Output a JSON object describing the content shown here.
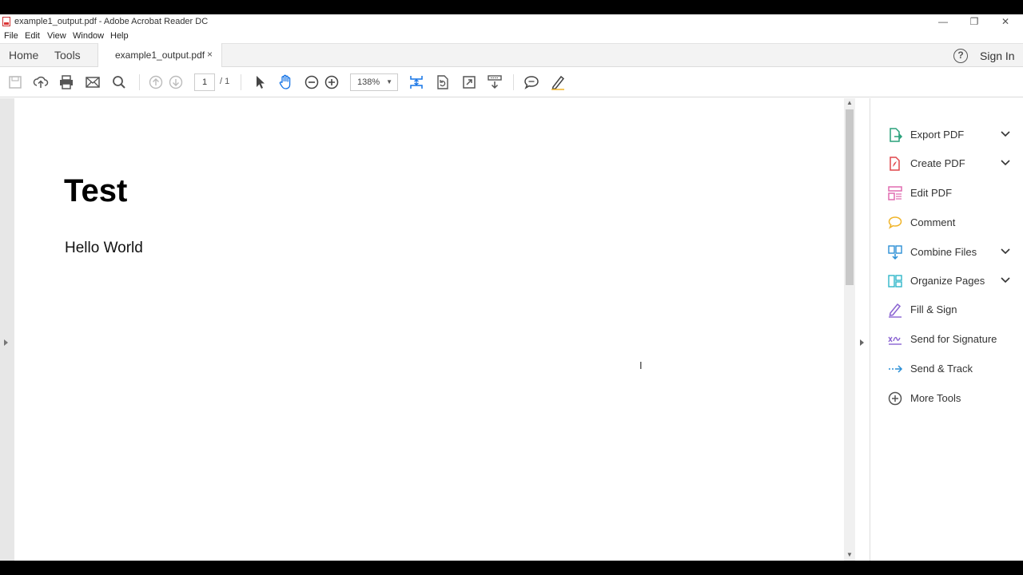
{
  "window": {
    "title": "example1_output.pdf - Adobe Acrobat Reader DC",
    "minimize": "—",
    "restore": "❐",
    "close": "✕"
  },
  "menu": [
    "File",
    "Edit",
    "View",
    "Window",
    "Help"
  ],
  "nav": {
    "home": "Home",
    "tools": "Tools",
    "doc_tab": "example1_output.pdf",
    "doc_tab_close": "×",
    "help": "?",
    "sign_in": "Sign In"
  },
  "toolbar": {
    "icons": [
      "save-icon",
      "upload-icon",
      "print-icon",
      "email-icon",
      "search-icon",
      "page-up-icon",
      "page-down-icon",
      "select-arrow-icon",
      "hand-icon",
      "zoom-out-icon",
      "zoom-in-icon",
      "fit-page-icon",
      "rotate-icon",
      "full-screen-icon",
      "scroll-mode-icon",
      "comment-icon",
      "highlight-pen-icon"
    ],
    "page_current": "1",
    "page_total": "/ 1",
    "zoom": "138%",
    "zoom_caret": "▼"
  },
  "document": {
    "heading": "Test",
    "body": "Hello World"
  },
  "scrollbar": {
    "up": "▲",
    "down": "▼"
  },
  "cursor": "I",
  "tools_pane": [
    {
      "label": "Export PDF",
      "icon": "export-pdf-icon",
      "color": "#28a07a",
      "expandable": true
    },
    {
      "label": "Create PDF",
      "icon": "create-pdf-icon",
      "color": "#e0464b",
      "expandable": true
    },
    {
      "label": "Edit PDF",
      "icon": "edit-pdf-icon",
      "color": "#e06bb0",
      "expandable": false
    },
    {
      "label": "Comment",
      "icon": "comment-icon",
      "color": "#f0b429",
      "expandable": false
    },
    {
      "label": "Combine Files",
      "icon": "combine-files-icon",
      "color": "#2b8fd6",
      "expandable": true
    },
    {
      "label": "Organize Pages",
      "icon": "organize-pages-icon",
      "color": "#2fb6c9",
      "expandable": true
    },
    {
      "label": "Fill & Sign",
      "icon": "fill-sign-icon",
      "color": "#8a63d2",
      "expandable": false
    },
    {
      "label": "Send for Signature",
      "icon": "send-signature-icon",
      "color": "#8a63d2",
      "expandable": false
    },
    {
      "label": "Send & Track",
      "icon": "send-track-icon",
      "color": "#2b8fd6",
      "expandable": false
    },
    {
      "label": "More Tools",
      "icon": "more-tools-icon",
      "color": "#555555",
      "expandable": false
    }
  ]
}
